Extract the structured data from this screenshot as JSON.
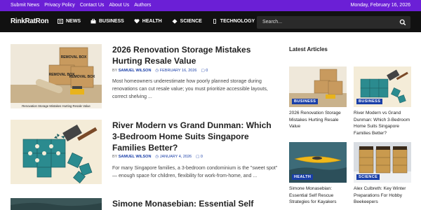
{
  "topbar": {
    "links": [
      "Submit News",
      "Privacy Policy",
      "Contact Us",
      "About Us",
      "Authors"
    ],
    "date": "Monday, February 16, 2026",
    "color": "#6b1fd6"
  },
  "header": {
    "logo": "RinkRatRon",
    "nav": [
      {
        "label": "NEWS",
        "icon": "newspaper-icon"
      },
      {
        "label": "BUSINESS",
        "icon": "briefcase-icon"
      },
      {
        "label": "HEALTH",
        "icon": "heart-icon"
      },
      {
        "label": "SCIENCE",
        "icon": "atom-icon"
      },
      {
        "label": "TECHNOLOGY",
        "icon": "phone-icon"
      }
    ],
    "search": {
      "placeholder": "Search..."
    }
  },
  "articles": [
    {
      "title": "2026 Renovation Storage Mistakes Hurting Resale Value",
      "author": "SAMUEL WILSON",
      "date": "FEBRUARY 16, 2026",
      "comments": "0",
      "excerpt": "Most homeowners underestimate how poorly planned storage during renovations can cut resale value; you must prioritize accessible layouts, correct shelving ...",
      "image_caption": "Renovation Storage Mistakes Hurting Resale Value",
      "box_label": "REMOVAL BOX"
    },
    {
      "title": "River Modern vs Grand Dunman: Which 3-Bedroom Home Suits Singapore Families Better?",
      "author": "SAMUEL WILSON",
      "date": "JANUARY 4, 2026",
      "comments": "0",
      "excerpt": "For many Singapore families, a 3-bedroom condominium is the \"sweet spot\" — enough space for children, flexibility for work-from-home, and ..."
    },
    {
      "title": "Simone Monasebian: Essential Self Rescue"
    }
  ],
  "sidebar": {
    "title": "Latest Articles",
    "items": [
      {
        "title": "2026 Renovation Storage Mistakes Hurting Resale Value",
        "badge": "BUSINESS"
      },
      {
        "title": "River Modern vs Grand Dunman: Which 3-Bedroom Home Suits Singapore Families Better?",
        "badge": "BUSINESS"
      },
      {
        "title": "Simone Monasebian: Essential Self Rescue Strategies for Kayakers",
        "badge": "HEALTH"
      },
      {
        "title": "Alex Culbreth: Key Winter Preparations For Hobby Beekeepers",
        "badge": "SCIENCE"
      }
    ]
  }
}
